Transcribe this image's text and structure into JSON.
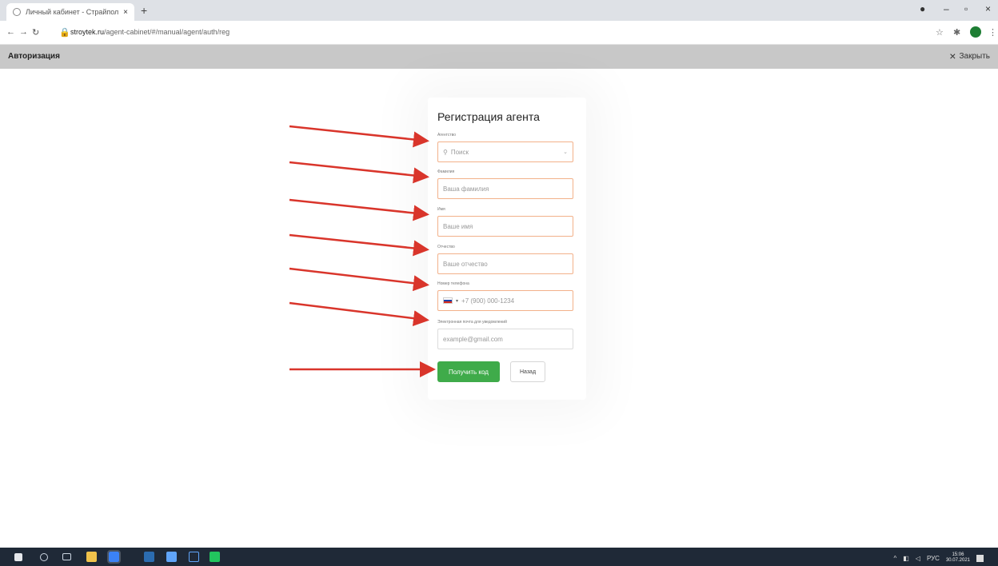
{
  "browser": {
    "tab_title": "Личный кабинет - Страйпол",
    "tab_close": "×",
    "new_tab": "+",
    "url_host": "stroytek.ru",
    "url_path": "/agent-cabinet/#/manual/agent/auth/reg",
    "win_min": "–",
    "win_max": "▫",
    "win_close": "×"
  },
  "app": {
    "header_title": "Авторизация",
    "close_label": "Закрыть",
    "close_icon": "×"
  },
  "form": {
    "title": "Регистрация агента",
    "fields": [
      {
        "label": "Агентство",
        "placeholder": "Поиск",
        "has_search_icon": true,
        "has_dropdown": true
      },
      {
        "label": "Фамилия",
        "placeholder": "Ваша фамилия"
      },
      {
        "label": "Имя",
        "placeholder": "Ваше имя"
      },
      {
        "label": "Отчество",
        "placeholder": "Ваше отчество"
      },
      {
        "label": "Номер телефона",
        "placeholder": "+7 (900) 000-1234",
        "has_flag": true
      },
      {
        "label": "Электронная почта для уведомлений",
        "placeholder": "example@gmail.com"
      }
    ],
    "submit_label": "Получить код",
    "back_label": "Назад"
  },
  "colors": {
    "accent_green": "#3fab4a",
    "field_border_orange": "#f2b18a",
    "arrow_red": "#d9352b",
    "header_gray": "#c8c8c8",
    "taskbar": "#1f2937"
  },
  "taskbar": {
    "lang": "РУС",
    "time": "15:06",
    "date": "30.07.2021"
  }
}
